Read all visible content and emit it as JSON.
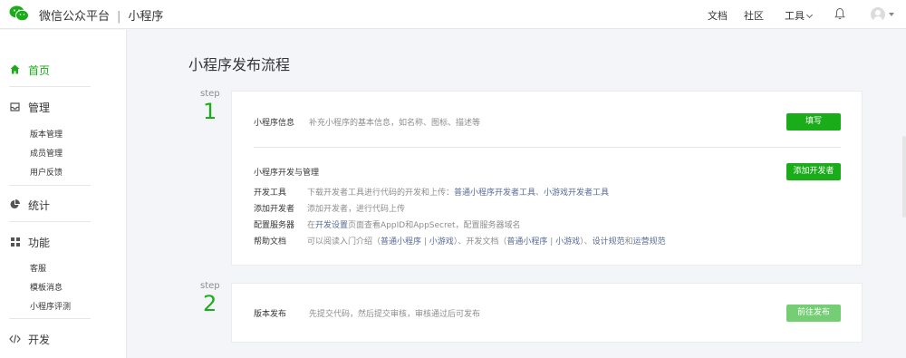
{
  "header": {
    "brand": "微信公众平台",
    "product": "小程序",
    "nav": {
      "docs": "文档",
      "community": "社区",
      "tools": "工具"
    },
    "icons": {
      "logo": "wechat-logo-icon",
      "bell": "bell-icon",
      "avatar": "avatar-icon"
    }
  },
  "sidebar": {
    "home": "首页",
    "manage": {
      "label": "管理",
      "items": [
        "版本管理",
        "成员管理",
        "用户反馈"
      ]
    },
    "stats": "统计",
    "features": {
      "label": "功能",
      "items": [
        "客服",
        "模板消息",
        "小程序评测"
      ]
    },
    "dev": "开发"
  },
  "main": {
    "title": "小程序发布流程",
    "step_word": "step",
    "step1": {
      "num": "1",
      "info": {
        "label": "小程序信息",
        "desc": "补充小程序的基本信息，如名称、图标、描述等",
        "button": "填写"
      },
      "dev": {
        "label": "小程序开发与管理",
        "button": "添加开发者",
        "rows": [
          {
            "label": "开发工具",
            "text": "下载开发者工具进行代码的开发和上传：",
            "link1": "普通小程序开发者工具",
            "mid": "、",
            "link2": "小游戏开发者工具"
          },
          {
            "label": "添加开发者",
            "text": "添加开发者，进行代码上传"
          },
          {
            "label": "配置服务器",
            "pre": "在",
            "link": "开发设置",
            "text": "页面查看AppID和AppSecret，配置服务器域名"
          },
          {
            "label": "帮助文档",
            "parts": [
              "可以阅读入门介绍（",
              "普通小程序",
              " | ",
              "小游戏",
              "）、开发文档（",
              "普通小程序",
              " | ",
              "小游戏",
              "）、",
              "设计规范",
              "和",
              "运营规范"
            ]
          }
        ]
      }
    },
    "step2": {
      "num": "2",
      "label": "版本发布",
      "desc": "先提交代码，然后提交审核，审核通过后可发布",
      "button": "前往发布"
    }
  },
  "colors": {
    "accent": "#1aad19",
    "link": "#576b95",
    "muted": "#8d8d8d"
  }
}
